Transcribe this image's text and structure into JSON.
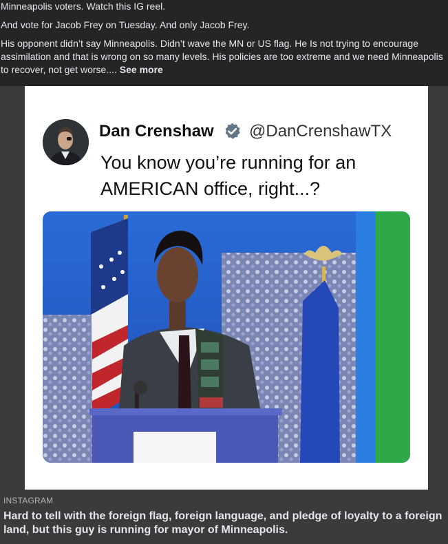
{
  "post": {
    "line1": "Minneapolis voters.   Watch this IG reel.",
    "line2": "And vote for Jacob Frey on Tuesday.   And only Jacob Frey.",
    "line3": "His opponent didn’t say Minneapolis.  Didn’t wave the MN or US flag.   He Is not trying to encourage assimilation and that is wrong on so many levels.   His policies are too extreme and we need Minneapolis to recover, not get worse....",
    "see_more": "See more"
  },
  "tweet": {
    "name": "Dan Crenshaw",
    "handle": "@DanCrenshawTX",
    "text": "You know you’re running for an AMERICAN office, right...?",
    "verified_icon": "verified-badge-icon",
    "verified_color": "#657786"
  },
  "link": {
    "source": "INSTAGRAM",
    "headline": "Hard to tell with the foreign flag, foreign language, and pledge of loyalty to a foreign land, but this guy is running for mayor of Minneapolis."
  },
  "colors": {
    "background": "#242526",
    "footer": "#3a3b3c",
    "text": "#e4e6eb"
  }
}
